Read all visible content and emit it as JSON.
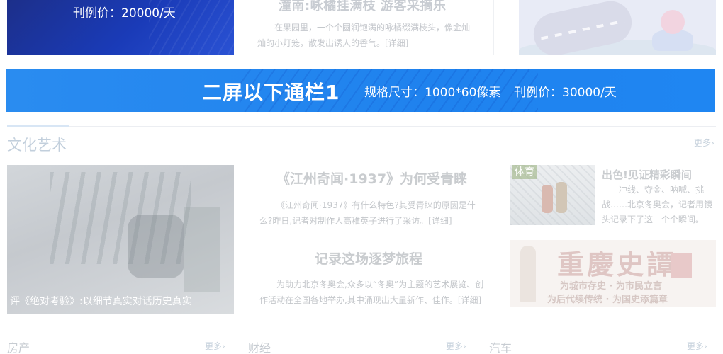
{
  "top": {
    "ad_price": "刊例价：20000/天",
    "mid_title": "潼南:咏橘挂满枝 游客采摘乐",
    "mid_text": "在果园里，一个个圆润饱满的咏橘缀满枝头，像金灿灿的小灯笼，散发出诱人的香气。[详细]"
  },
  "banner": {
    "title": "二屏以下通栏1",
    "spec": "规格尺寸：1000*60像素",
    "price": "刊例价：30000/天",
    "color": "#1f84f0"
  },
  "culture": {
    "section_title": "文化艺术",
    "more": "更多",
    "photo_caption": "评《绝对考验》:以细节真实对话历史真实",
    "articles": [
      {
        "title": "《江州奇闻·1937》为何受青睐",
        "text": "《江州奇闻·1937》有什么特色?其受青睐的原因是什么?昨日,记者对制作人高稚英子进行了采访。[详细]"
      },
      {
        "title": "记录这场逐梦旅程",
        "text": "为助力北京冬奥会,众多以“冬奥”为主题的艺术展览、创作活动在全国各地举办,其中涌现出大量新作、佳作。[详细]"
      }
    ],
    "sport": {
      "tag": "体育",
      "title": "出色!见证精彩瞬间",
      "text": "冲线、夺金、呐喊、挑战……北京冬奥会，记者用镜头记录下了这一个个瞬间。"
    },
    "chongqing": {
      "big": "重慶史譚",
      "line1": "为城市存史 · 为市民立言",
      "line2": "为后代续传统 · 为国史添篇章"
    }
  },
  "bottom": {
    "sections": [
      {
        "title": "房产",
        "more": "更多"
      },
      {
        "title": "财经",
        "more": "更多"
      },
      {
        "title": "汽车",
        "more": "更多"
      }
    ]
  }
}
